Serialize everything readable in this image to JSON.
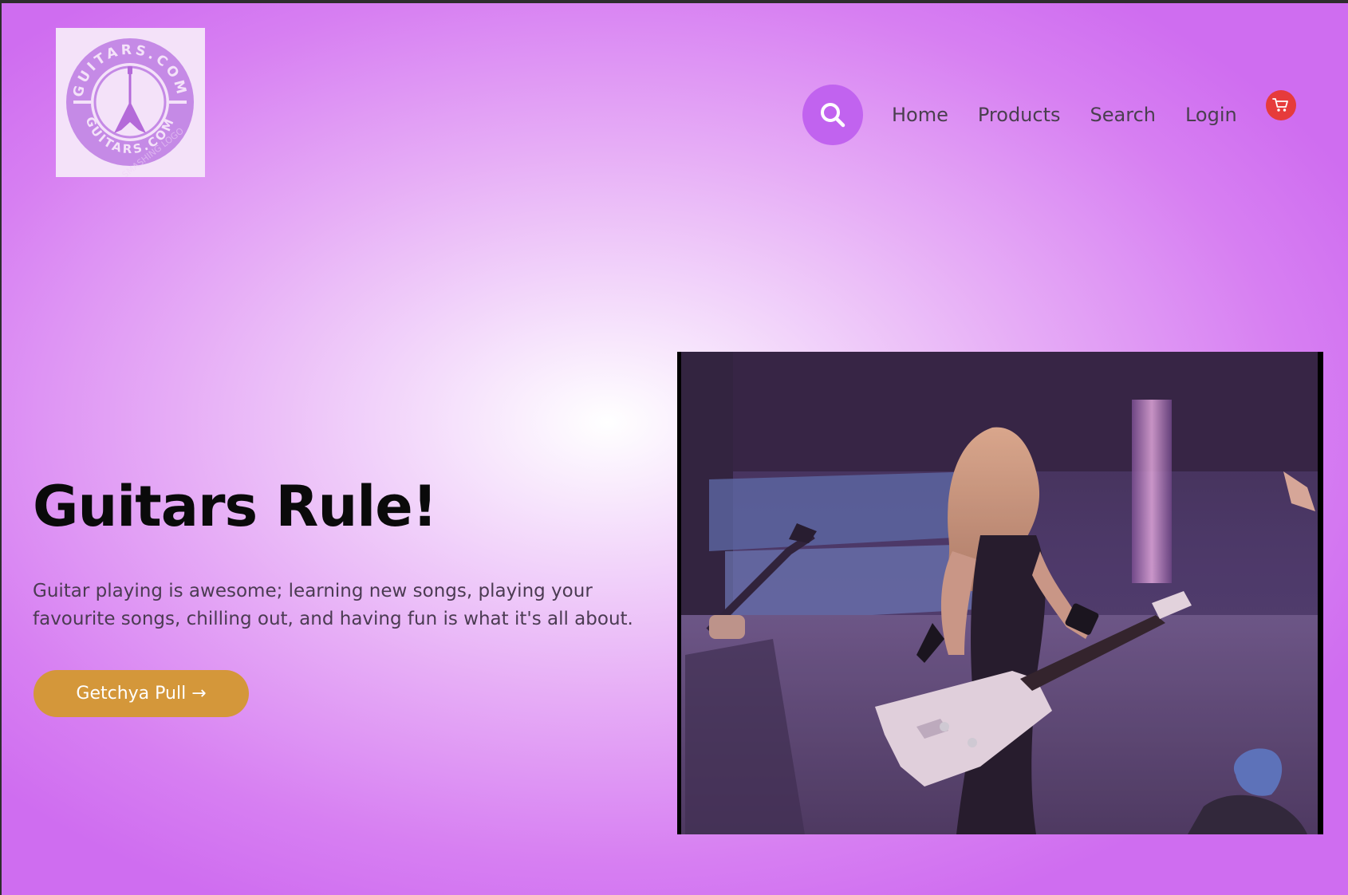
{
  "header": {
    "logo": {
      "icon": "guitars-com-logo",
      "ring_text": "GUITARS.COM",
      "watermark": "SMASHING LOGO"
    },
    "search_button": {
      "icon": "search-icon"
    },
    "nav": [
      {
        "label": "Home"
      },
      {
        "label": "Products"
      },
      {
        "label": "Search"
      },
      {
        "label": "Login"
      }
    ],
    "cart": {
      "icon": "cart-icon",
      "color": "#e63b3b"
    }
  },
  "hero": {
    "title": "Guitars Rule!",
    "description": "Guitar playing is awesome; learning new songs, playing your favourite songs, chilling out, and having fun is what it's all about.",
    "cta_label": "Getchya Pull →",
    "cta_color": "#d4973a"
  },
  "media": {
    "content": "concert-video-frame",
    "subject": "guitarist playing a white explorer-style guitar on stage"
  },
  "colors": {
    "accent": "#c163ef",
    "background_edge": "#cf6df0",
    "title": "#0a0a0a",
    "body_text": "#4b3b52"
  }
}
